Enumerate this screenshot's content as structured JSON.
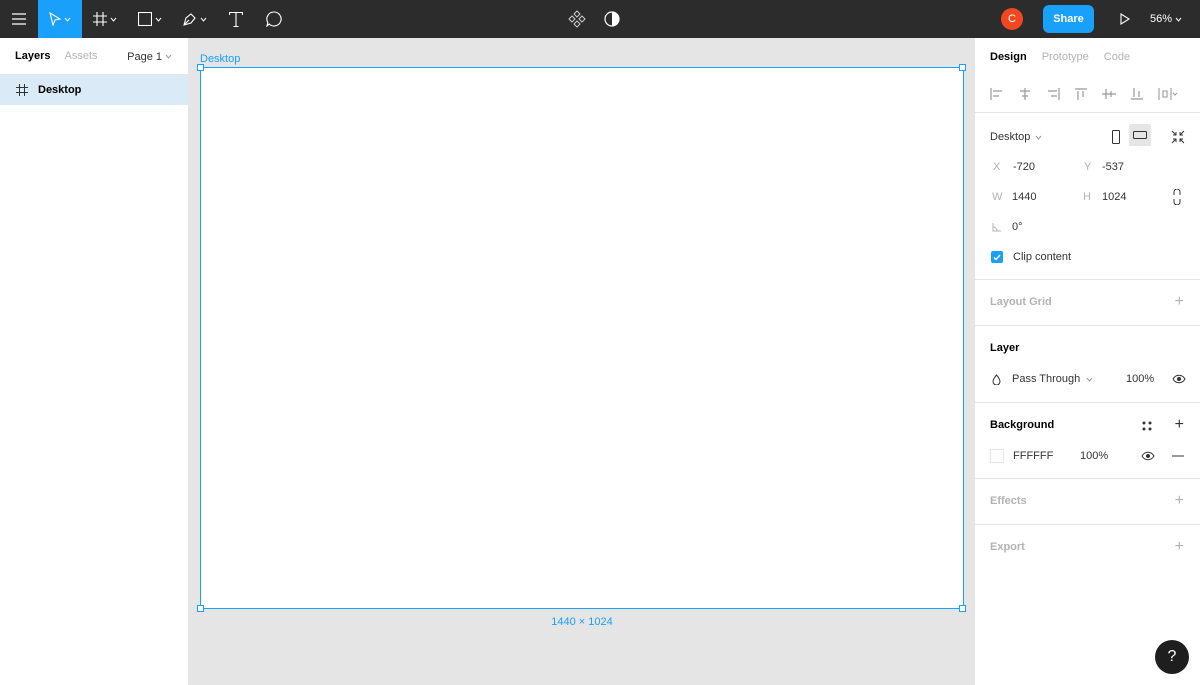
{
  "toolbar": {
    "share_label": "Share",
    "avatar_initial": "C",
    "zoom": "56%"
  },
  "left_panel": {
    "tabs": [
      "Layers",
      "Assets"
    ],
    "page": "Page 1",
    "layers": [
      {
        "name": "Desktop",
        "icon": "frame-icon"
      }
    ]
  },
  "canvas": {
    "frame_name": "Desktop",
    "frame_size": "1440 × 1024"
  },
  "right_panel": {
    "tabs": [
      "Design",
      "Prototype",
      "Code"
    ],
    "frame_preset": "Desktop",
    "x_label": "X",
    "x": "-720",
    "y_label": "Y",
    "y": "-537",
    "w_label": "W",
    "w": "1440",
    "h_label": "H",
    "h": "1024",
    "rotation": "0°",
    "clip_content": "Clip content",
    "layout_grid": "Layout Grid",
    "layer_title": "Layer",
    "blend_mode": "Pass Through",
    "layer_opacity": "100%",
    "background_title": "Background",
    "fill_hex": "FFFFFF",
    "fill_opacity": "100%",
    "effects": "Effects",
    "export": "Export"
  },
  "help_label": "?",
  "colors": {
    "accent": "#18a0fb",
    "toolbar": "#2c2c2c",
    "avatar": "#f24822"
  }
}
